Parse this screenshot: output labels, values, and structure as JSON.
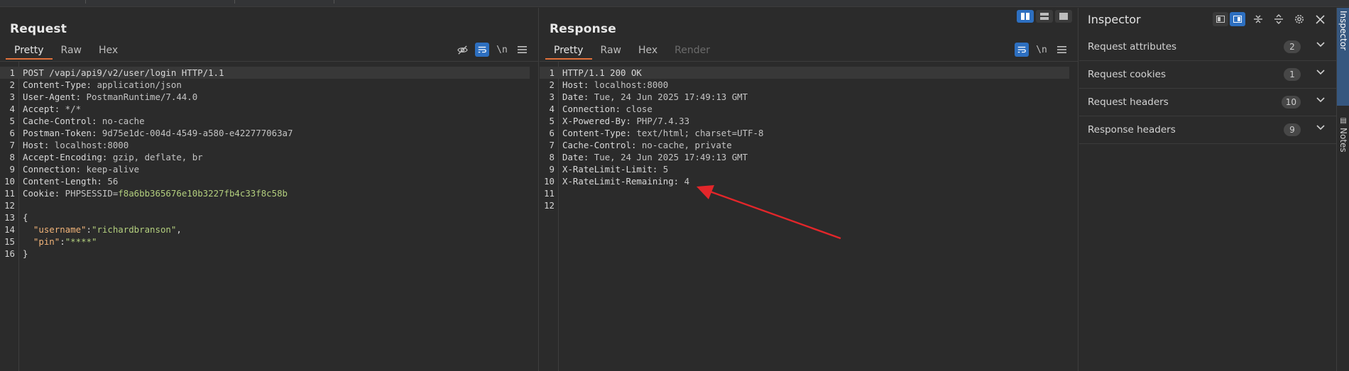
{
  "request": {
    "title": "Request",
    "tabs": [
      {
        "label": "Pretty",
        "active": true
      },
      {
        "label": "Raw",
        "active": false
      },
      {
        "label": "Hex",
        "active": false
      }
    ],
    "tools": {
      "hide_icon": "eye-off-icon",
      "wrap_icon": "wrap-lines-icon",
      "newline_label": "\\n",
      "menu_icon": "hamburger-menu-icon"
    },
    "lines": [
      {
        "n": "1",
        "text": "POST /vapi/api9/v2/user/login HTTP/1.1"
      },
      {
        "n": "2",
        "key": "Content-Type:",
        "val": " application/json"
      },
      {
        "n": "3",
        "key": "User-Agent:",
        "val": " PostmanRuntime/7.44.0"
      },
      {
        "n": "4",
        "key": "Accept:",
        "val": " */*"
      },
      {
        "n": "5",
        "key": "Cache-Control:",
        "val": " no-cache"
      },
      {
        "n": "6",
        "key": "Postman-Token:",
        "val": " 9d75e1dc-004d-4549-a580-e422777063a7"
      },
      {
        "n": "7",
        "key": "Host:",
        "val": " localhost:8000"
      },
      {
        "n": "8",
        "key": "Accept-Encoding:",
        "val": " gzip, deflate, br"
      },
      {
        "n": "9",
        "key": "Connection:",
        "val": " keep-alive"
      },
      {
        "n": "10",
        "key": "Content-Length:",
        "val": " 56"
      },
      {
        "n": "11",
        "key": "Cookie:",
        "cookie_name": " PHPSESSID",
        "cookie_eq": "=",
        "cookie_val": "f8a6bb365676e10b3227fb4c33f8c58b"
      },
      {
        "n": "12",
        "text": ""
      },
      {
        "n": "13",
        "text": "{"
      },
      {
        "n": "14",
        "json_key": "  \"username\"",
        "colon": ":",
        "json_val": "\"richardbranson\"",
        "tail": ","
      },
      {
        "n": "15",
        "json_key": "  \"pin\"",
        "colon": ":",
        "json_val": "\"****\"",
        "tail": ""
      },
      {
        "n": "16",
        "text": "}"
      }
    ]
  },
  "response": {
    "title": "Response",
    "tabs": [
      {
        "label": "Pretty",
        "active": true
      },
      {
        "label": "Raw",
        "active": false
      },
      {
        "label": "Hex",
        "active": false
      },
      {
        "label": "Render",
        "active": false,
        "disabled": true
      }
    ],
    "tools": {
      "wrap_icon": "wrap-lines-icon",
      "newline_label": "\\n",
      "menu_icon": "hamburger-menu-icon"
    },
    "lines": [
      {
        "n": "1",
        "text": "HTTP/1.1 200 OK"
      },
      {
        "n": "2",
        "key": "Host:",
        "val": " localhost:8000"
      },
      {
        "n": "3",
        "key": "Date:",
        "val": " Tue, 24 Jun 2025 17:49:13 GMT"
      },
      {
        "n": "4",
        "key": "Connection:",
        "val": " close"
      },
      {
        "n": "5",
        "key": "X-Powered-By:",
        "val": " PHP/7.4.33"
      },
      {
        "n": "6",
        "key": "Content-Type:",
        "val": " text/html; charset=UTF-8"
      },
      {
        "n": "7",
        "key": "Cache-Control:",
        "val": " no-cache, private"
      },
      {
        "n": "8",
        "key": "Date:",
        "val": " Tue, 24 Jun 2025 17:49:13 GMT"
      },
      {
        "n": "9",
        "key": "X-RateLimit-Limit:",
        "val": " 5"
      },
      {
        "n": "10",
        "key": "X-RateLimit-Remaining:",
        "val": " 4"
      },
      {
        "n": "11",
        "text": ""
      },
      {
        "n": "12",
        "text": ""
      }
    ]
  },
  "layout_toggle": {
    "icons": [
      "split-horizontal-icon",
      "split-vertical-icon",
      "single-pane-icon"
    ],
    "active_index": 0
  },
  "inspector": {
    "title": "Inspector",
    "tools": [
      "layout-left-icon",
      "layout-right-icon",
      "collapse-all-icon",
      "expand-all-icon",
      "settings-icon",
      "close-icon"
    ],
    "rows": [
      {
        "label": "Request attributes",
        "count": "2"
      },
      {
        "label": "Request cookies",
        "count": "1"
      },
      {
        "label": "Request headers",
        "count": "10"
      },
      {
        "label": "Response headers",
        "count": "9"
      }
    ]
  },
  "right_sidebar": {
    "tabs": [
      {
        "label": "Inspector",
        "active": true
      },
      {
        "label": "Notes",
        "active": false
      }
    ]
  },
  "annotation": {
    "color": "#e3262a",
    "points_to": "X-RateLimit-Remaining"
  },
  "colors": {
    "accent": "#2d6fc0",
    "active_tab_underline": "#e0703a",
    "header_value_green": "#b3cf7e",
    "json_key_orange": "#f2b479"
  }
}
